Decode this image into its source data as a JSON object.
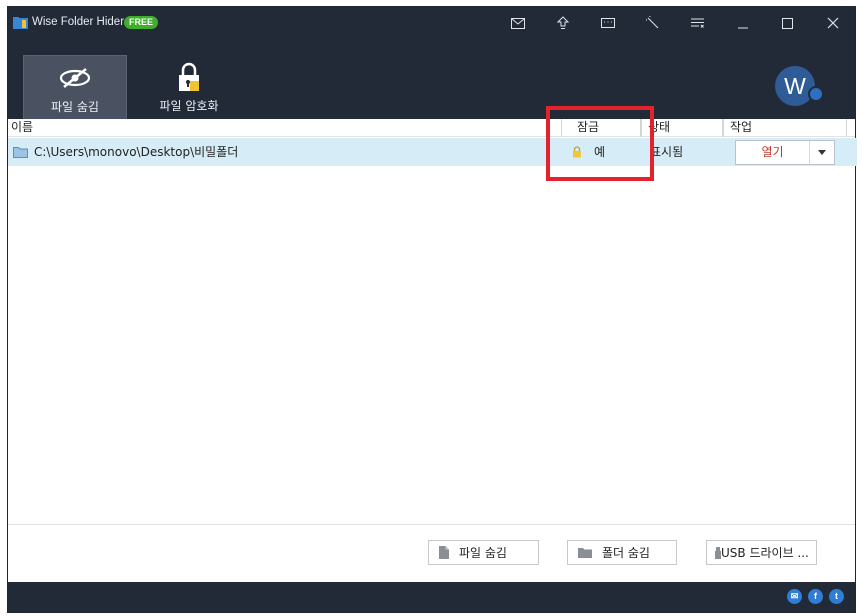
{
  "window": {
    "title": "Wise Folder Hider",
    "badge": "FREE"
  },
  "titlebar_icons": [
    "mail-icon",
    "upgrade-icon",
    "chat-icon",
    "tools-icon",
    "menu-icon",
    "minimize-icon",
    "maximize-icon",
    "close-icon"
  ],
  "tabs": [
    {
      "label": "파일 숨김",
      "icon": "eye-off-icon",
      "active": true
    },
    {
      "label": "파일 암호화",
      "icon": "lock-icon",
      "active": false
    }
  ],
  "avatar": {
    "letter": "W"
  },
  "table": {
    "headers": {
      "name": "이름",
      "lock": "잠금",
      "state": "상태",
      "action": "작업"
    },
    "rows": [
      {
        "path": "C:\\Users\\monovo\\Desktop\\비밀폴더",
        "lock": "예",
        "state": "표시됨",
        "action": "열기"
      }
    ]
  },
  "buttons": {
    "hide_file": "파일 숨김",
    "hide_folder": "폴더 숨김",
    "usb_drive": "USB 드라이브 ..."
  },
  "colors": {
    "dark_bg": "#222a38",
    "row_highlight": "#d6ecf6",
    "annotation_red": "#e3232b",
    "free_badge": "#3fae2a",
    "open_text": "#c0392b"
  }
}
